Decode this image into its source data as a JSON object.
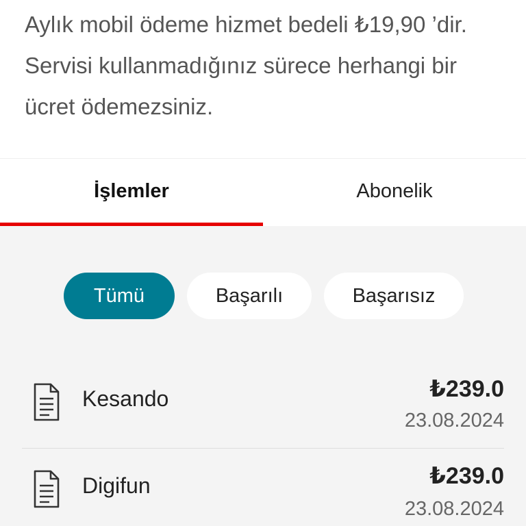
{
  "info": {
    "line1": "Aylık mobil ödeme hizmet bedeli ₺19,90 ’dir.",
    "line2": "Servisi kullanmadığınız sürece herhangi bir",
    "line3": "ücret ödemezsiniz."
  },
  "tabs": [
    {
      "label": "İşlemler",
      "active": true
    },
    {
      "label": "Abonelik",
      "active": false
    }
  ],
  "filters": [
    {
      "label": "Tümü",
      "active": true
    },
    {
      "label": "Başarılı",
      "active": false
    },
    {
      "label": "Başarısız",
      "active": false
    }
  ],
  "transactions": [
    {
      "icon": "document-icon",
      "name": "Kesando",
      "amount": "₺239.0",
      "date": "23.08.2024"
    },
    {
      "icon": "document-icon",
      "name": "Digifun",
      "amount": "₺239.0",
      "date": "23.08.2024"
    }
  ],
  "colors": {
    "accent_red": "#e60000",
    "chip_active": "#007c92",
    "content_bg": "#f4f4f4"
  }
}
